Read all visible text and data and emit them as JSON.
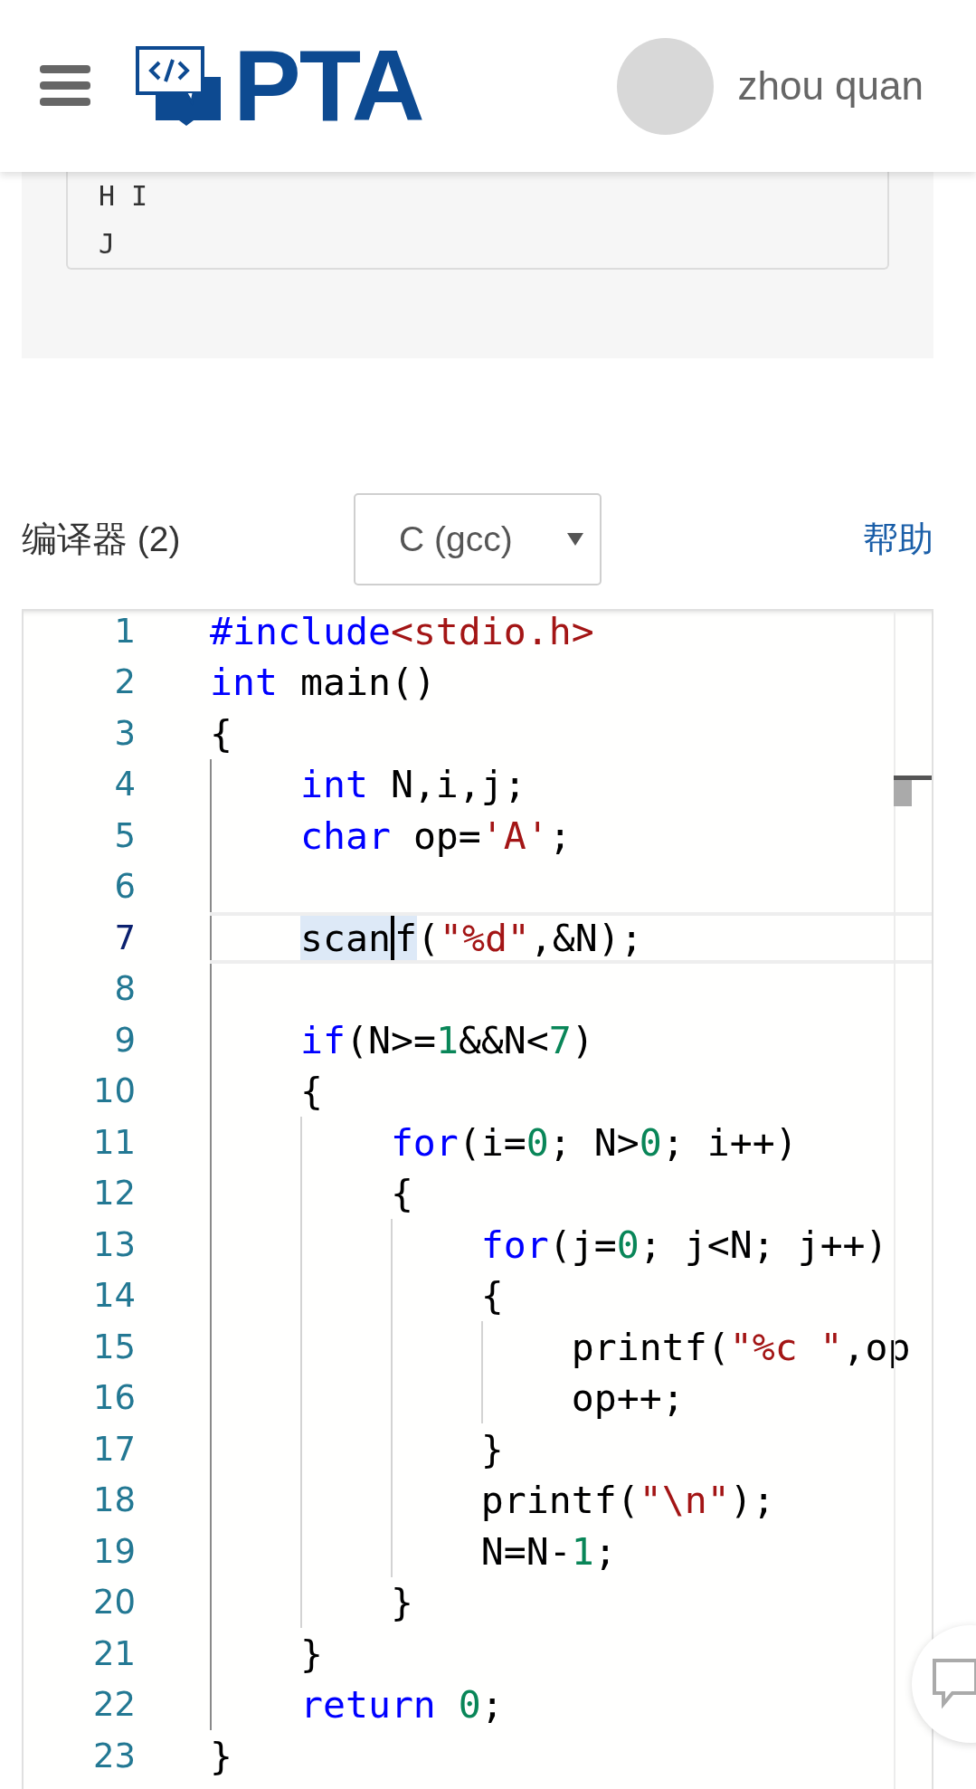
{
  "header": {
    "logo_text": "PTA",
    "user_name": "zhou quan"
  },
  "output_box": {
    "lines": [
      "H I",
      "J"
    ]
  },
  "compiler": {
    "label": "编译器 (2)",
    "select_value": "C (gcc)",
    "help_link": "帮助"
  },
  "editor": {
    "lines": [
      {
        "number": "1",
        "active": false,
        "tokens": [
          {
            "kind": "keyword",
            "text": "#include"
          },
          {
            "kind": "string",
            "text": "<stdio.h>"
          }
        ]
      },
      {
        "number": "2",
        "active": false,
        "tokens": [
          {
            "kind": "keyword",
            "text": "int"
          },
          {
            "kind": "plain",
            "text": " main()"
          }
        ]
      },
      {
        "number": "3",
        "active": false,
        "tokens": [
          {
            "kind": "plain",
            "text": "{"
          }
        ]
      },
      {
        "number": "4",
        "active": false,
        "tokens": [
          {
            "kind": "keyword",
            "text": "    int"
          },
          {
            "kind": "plain",
            "text": " N,i,j;"
          }
        ]
      },
      {
        "number": "5",
        "active": false,
        "tokens": [
          {
            "kind": "keyword",
            "text": "    char"
          },
          {
            "kind": "plain",
            "text": " op="
          },
          {
            "kind": "string",
            "text": "'A'"
          },
          {
            "kind": "plain",
            "text": ";"
          }
        ]
      },
      {
        "number": "6",
        "active": false
      },
      {
        "number": "7",
        "active": true,
        "tokens": [
          {
            "kind": "selection",
            "text": "    scan",
            "caret": true
          },
          {
            "kind": "selection",
            "text": "f",
            "caret": false
          },
          {
            "kind": "plain",
            "text": "("
          },
          {
            "kind": "string",
            "text": "\"%d\""
          },
          {
            "kind": "plain",
            "text": ",&N);"
          }
        ]
      },
      {
        "number": "8",
        "active": false
      },
      {
        "number": "9",
        "active": false,
        "tokens": [
          {
            "kind": "keyword",
            "text": "    if"
          },
          {
            "kind": "plain",
            "text": "(N>="
          },
          {
            "kind": "number",
            "text": "1"
          },
          {
            "kind": "plain",
            "text": "&&N<"
          },
          {
            "kind": "number",
            "text": "7"
          },
          {
            "kind": "plain",
            "text": ")"
          }
        ]
      },
      {
        "number": "10",
        "active": false,
        "tokens": [
          {
            "kind": "plain",
            "text": "    {"
          }
        ]
      },
      {
        "number": "11",
        "active": false,
        "tokens": [
          {
            "kind": "keyword",
            "text": "        for"
          },
          {
            "kind": "plain",
            "text": "(i="
          },
          {
            "kind": "number",
            "text": "0"
          },
          {
            "kind": "plain",
            "text": "; N>"
          },
          {
            "kind": "number",
            "text": "0"
          },
          {
            "kind": "plain",
            "text": "; i++)"
          }
        ]
      },
      {
        "number": "12",
        "active": false,
        "tokens": [
          {
            "kind": "plain",
            "text": "        {"
          }
        ]
      },
      {
        "number": "13",
        "active": false,
        "tokens": [
          {
            "kind": "keyword",
            "text": "            for"
          },
          {
            "kind": "plain",
            "text": "(j="
          },
          {
            "kind": "number",
            "text": "0"
          },
          {
            "kind": "plain",
            "text": "; j<N; j++)"
          }
        ]
      },
      {
        "number": "14",
        "active": false,
        "tokens": [
          {
            "kind": "plain",
            "text": "            {"
          }
        ]
      },
      {
        "number": "15",
        "active": false,
        "tokens": [
          {
            "kind": "plain",
            "text": "                printf("
          },
          {
            "kind": "string",
            "text": "\"%c \""
          },
          {
            "kind": "plain",
            "text": ",op"
          }
        ]
      },
      {
        "number": "16",
        "active": false,
        "tokens": [
          {
            "kind": "plain",
            "text": "                op++;"
          }
        ]
      },
      {
        "number": "17",
        "active": false,
        "tokens": [
          {
            "kind": "plain",
            "text": "            }"
          }
        ]
      },
      {
        "number": "18",
        "active": false,
        "tokens": [
          {
            "kind": "plain",
            "text": "            printf("
          },
          {
            "kind": "string",
            "text": "\"\\n\""
          },
          {
            "kind": "plain",
            "text": ");"
          }
        ]
      },
      {
        "number": "19",
        "active": false,
        "tokens": [
          {
            "kind": "plain",
            "text": "            N=N-"
          },
          {
            "kind": "number",
            "text": "1"
          },
          {
            "kind": "plain",
            "text": ";"
          }
        ]
      },
      {
        "number": "20",
        "active": false,
        "tokens": [
          {
            "kind": "plain",
            "text": "        }"
          }
        ]
      },
      {
        "number": "21",
        "active": false,
        "tokens": [
          {
            "kind": "plain",
            "text": "    }"
          }
        ]
      },
      {
        "number": "22",
        "active": false,
        "tokens": [
          {
            "kind": "keyword",
            "text": "    return "
          },
          {
            "kind": "number",
            "text": "0"
          },
          {
            "kind": "plain",
            "text": ";"
          }
        ]
      },
      {
        "number": "23",
        "active": false,
        "tokens": [
          {
            "kind": "plain",
            "text": "}"
          }
        ]
      }
    ]
  }
}
